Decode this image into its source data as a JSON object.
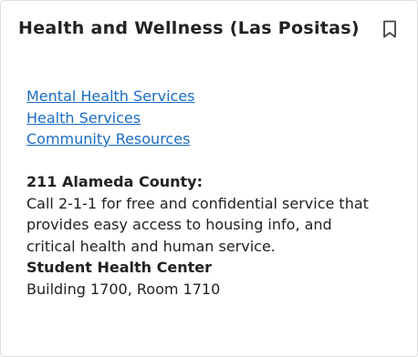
{
  "card": {
    "title": "Health and Wellness (Las Positas)",
    "bookmark_icon": "bookmark-outline-icon",
    "links": [
      {
        "label": "Mental Health Services"
      },
      {
        "label": "Health Services"
      },
      {
        "label": "Community Resources"
      }
    ],
    "sections": {
      "county_heading": "211 Alameda County:",
      "county_text": "Call 2-1-1 for free and confidential service that provides easy access to housing info, and critical health and human service.",
      "center_heading": "Student Health Center",
      "center_location": "Building 1700, Room 1710"
    },
    "colors": {
      "link": "#1a6cc4",
      "text": "#222222",
      "border": "#dcdcdc"
    }
  }
}
